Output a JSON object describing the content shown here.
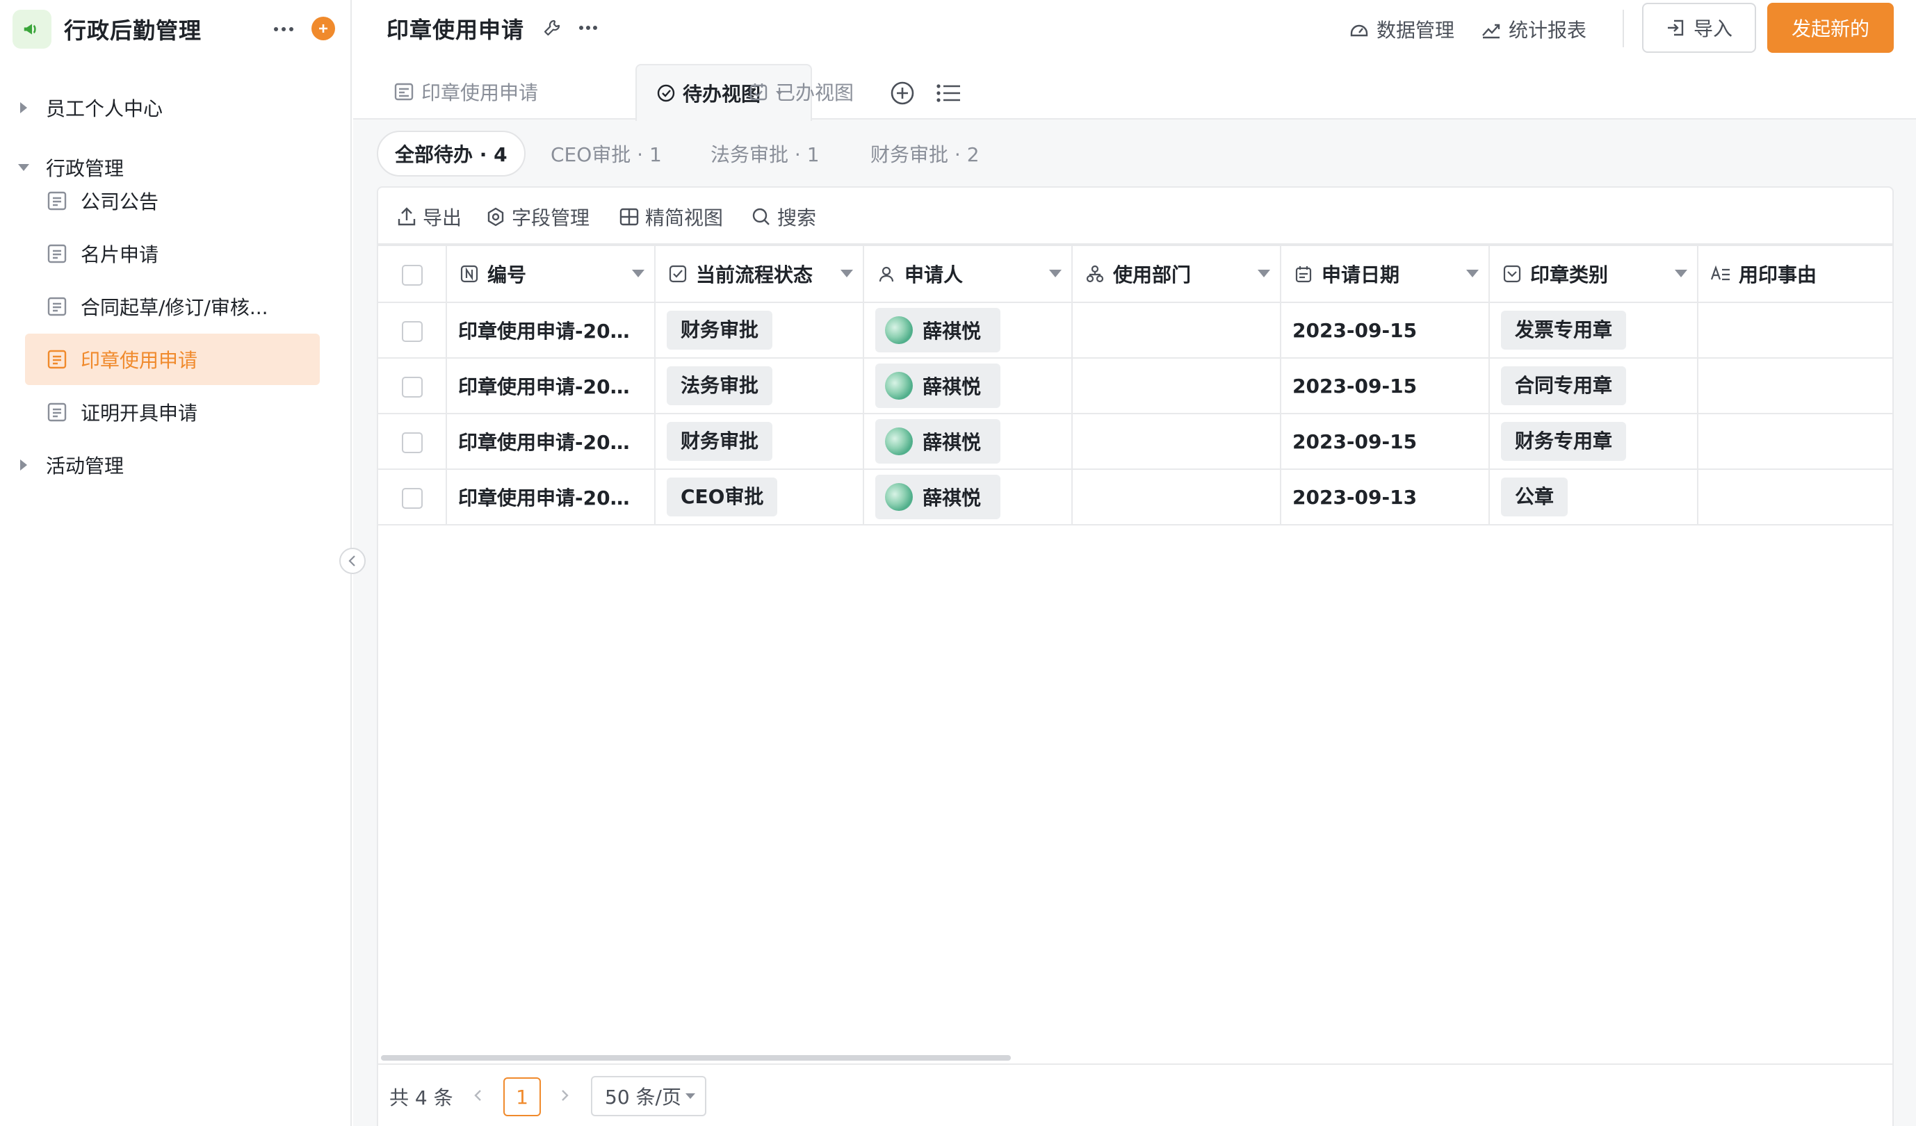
{
  "app": {
    "name": "行政后勤管理",
    "icon": "megaphone-icon",
    "brand_color": "#f08a2c"
  },
  "sidebar": {
    "groups": [
      {
        "label": "员工个人中心",
        "expanded": false
      },
      {
        "label": "行政管理",
        "expanded": true
      },
      {
        "label": "活动管理",
        "expanded": false
      }
    ],
    "items": [
      {
        "label": "公司公告"
      },
      {
        "label": "名片申请"
      },
      {
        "label": "合同起草/修订/审核..."
      },
      {
        "label": "印章使用申请",
        "active": true
      },
      {
        "label": "证明开具申请"
      }
    ]
  },
  "header": {
    "title": "印章使用申请",
    "links": {
      "data_manage": "数据管理",
      "report": "统计报表"
    },
    "import_label": "导入",
    "new_label": "发起新的"
  },
  "tabs": [
    {
      "label": "印章使用申请",
      "icon": "form-icon"
    },
    {
      "label": "待办视图",
      "icon": "check-circle-icon",
      "active": true
    },
    {
      "label": "已办视图",
      "icon": "calendar-check-icon"
    }
  ],
  "filters": [
    {
      "label": "全部待办 · 4",
      "active": true
    },
    {
      "label": "CEO审批 · 1"
    },
    {
      "label": "法务审批 · 1"
    },
    {
      "label": "财务审批 · 2"
    }
  ],
  "toolbar": {
    "export": "导出",
    "fields": "字段管理",
    "compact": "精简视图",
    "search": "搜索"
  },
  "table": {
    "columns": [
      {
        "label": "编号",
        "icon": "number-icon"
      },
      {
        "label": "当前流程状态",
        "icon": "checkbox-icon"
      },
      {
        "label": "申请人",
        "icon": "user-icon"
      },
      {
        "label": "使用部门",
        "icon": "org-icon"
      },
      {
        "label": "申请日期",
        "icon": "calendar-icon"
      },
      {
        "label": "印章类别",
        "icon": "select-icon"
      },
      {
        "label": "用印事由",
        "icon": "text-icon"
      }
    ],
    "rows": [
      {
        "id": "印章使用申请-202...",
        "status": "财务审批",
        "applicant": "薛祺悦",
        "dept": "",
        "date": "2023-09-15",
        "seal": "发票专用章",
        "reason": ""
      },
      {
        "id": "印章使用申请-202...",
        "status": "法务审批",
        "applicant": "薛祺悦",
        "dept": "",
        "date": "2023-09-15",
        "seal": "合同专用章",
        "reason": ""
      },
      {
        "id": "印章使用申请-202...",
        "status": "财务审批",
        "applicant": "薛祺悦",
        "dept": "",
        "date": "2023-09-15",
        "seal": "财务专用章",
        "reason": ""
      },
      {
        "id": "印章使用申请-202...",
        "status": "CEO审批",
        "applicant": "薛祺悦",
        "dept": "",
        "date": "2023-09-13",
        "seal": "公章",
        "reason": ""
      }
    ]
  },
  "pagination": {
    "total": "共 4 条",
    "page": "1",
    "page_size": "50 条/页"
  }
}
